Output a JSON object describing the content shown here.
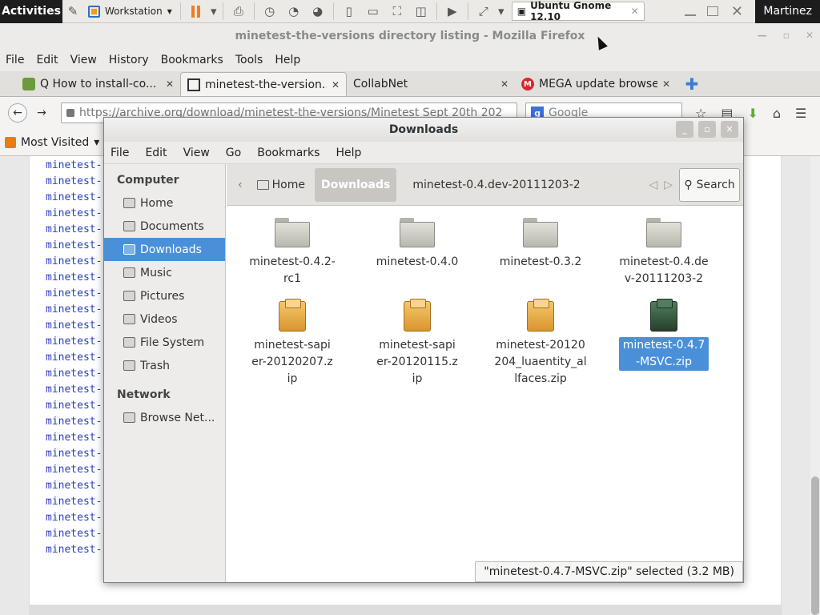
{
  "hostbar": {
    "activities": "Activities",
    "workspace": "Workstation",
    "vm_tab": "Ubuntu Gnome 12.10",
    "user": "Martinez"
  },
  "firefox": {
    "window_title": "minetest-the-versions directory listing - Mozilla Firefox",
    "menu": [
      "File",
      "Edit",
      "View",
      "History",
      "Bookmarks",
      "Tools",
      "Help"
    ],
    "tabs": [
      {
        "label": "Q How to install-co..."
      },
      {
        "label": "minetest-the-version..."
      },
      {
        "label": "CollabNet"
      },
      {
        "label": "MEGA update browser"
      }
    ],
    "url": "https://archive.org/download/minetest-the-versions/Minetest Sept 20th 202",
    "search_placeholder": "Google",
    "bookmarks_label": "Most Visited",
    "listing": [
      "minetest-",
      "minetest-",
      "minetest-",
      "minetest-",
      "minetest-",
      "minetest-",
      "minetest-",
      "minetest-",
      "minetest-",
      "minetest-",
      "minetest-",
      "minetest-",
      "minetest-",
      "minetest-",
      "minetest-",
      "minetest-",
      "minetest-",
      "minetest-",
      "minetest-",
      "minetest-",
      "minetest-",
      "minetest-",
      "minetest-",
      "minetest-",
      "minetest-"
    ]
  },
  "nautilus": {
    "title": "Downloads",
    "menu": [
      "File",
      "Edit",
      "View",
      "Go",
      "Bookmarks",
      "Help"
    ],
    "sidebar": {
      "computer_heading": "Computer",
      "items": [
        {
          "label": "Home",
          "selected": false
        },
        {
          "label": "Documents",
          "selected": false
        },
        {
          "label": "Downloads",
          "selected": true
        },
        {
          "label": "Music",
          "selected": false
        },
        {
          "label": "Pictures",
          "selected": false
        },
        {
          "label": "Videos",
          "selected": false
        },
        {
          "label": "File System",
          "selected": false
        },
        {
          "label": "Trash",
          "selected": false
        }
      ],
      "network_heading": "Network",
      "network_items": [
        {
          "label": "Browse Net..."
        }
      ]
    },
    "path": {
      "home": "Home",
      "current": "Downloads",
      "next": "minetest-0.4.dev-20111203-2"
    },
    "search_label": "Search",
    "files": [
      {
        "name": "minetest-0.4.2-rc1",
        "type": "folder",
        "selected": false
      },
      {
        "name": "minetest-0.4.0",
        "type": "folder",
        "selected": false
      },
      {
        "name": "minetest-0.3.2",
        "type": "folder",
        "selected": false
      },
      {
        "name": "minetest-0.4.dev-20111203-2",
        "type": "folder",
        "selected": false
      },
      {
        "name": "minetest-sapier-20120207.zip",
        "type": "zip",
        "selected": false
      },
      {
        "name": "minetest-sapier-20120115.zip",
        "type": "zip",
        "selected": false
      },
      {
        "name": "minetest-20120204_luaentity_allfaces.zip",
        "type": "zip",
        "selected": false
      },
      {
        "name": "minetest-0.4.7-MSVC.zip",
        "type": "zip-green",
        "selected": true
      }
    ],
    "status": "\"minetest-0.4.7-MSVC.zip\" selected (3.2 MB)"
  }
}
